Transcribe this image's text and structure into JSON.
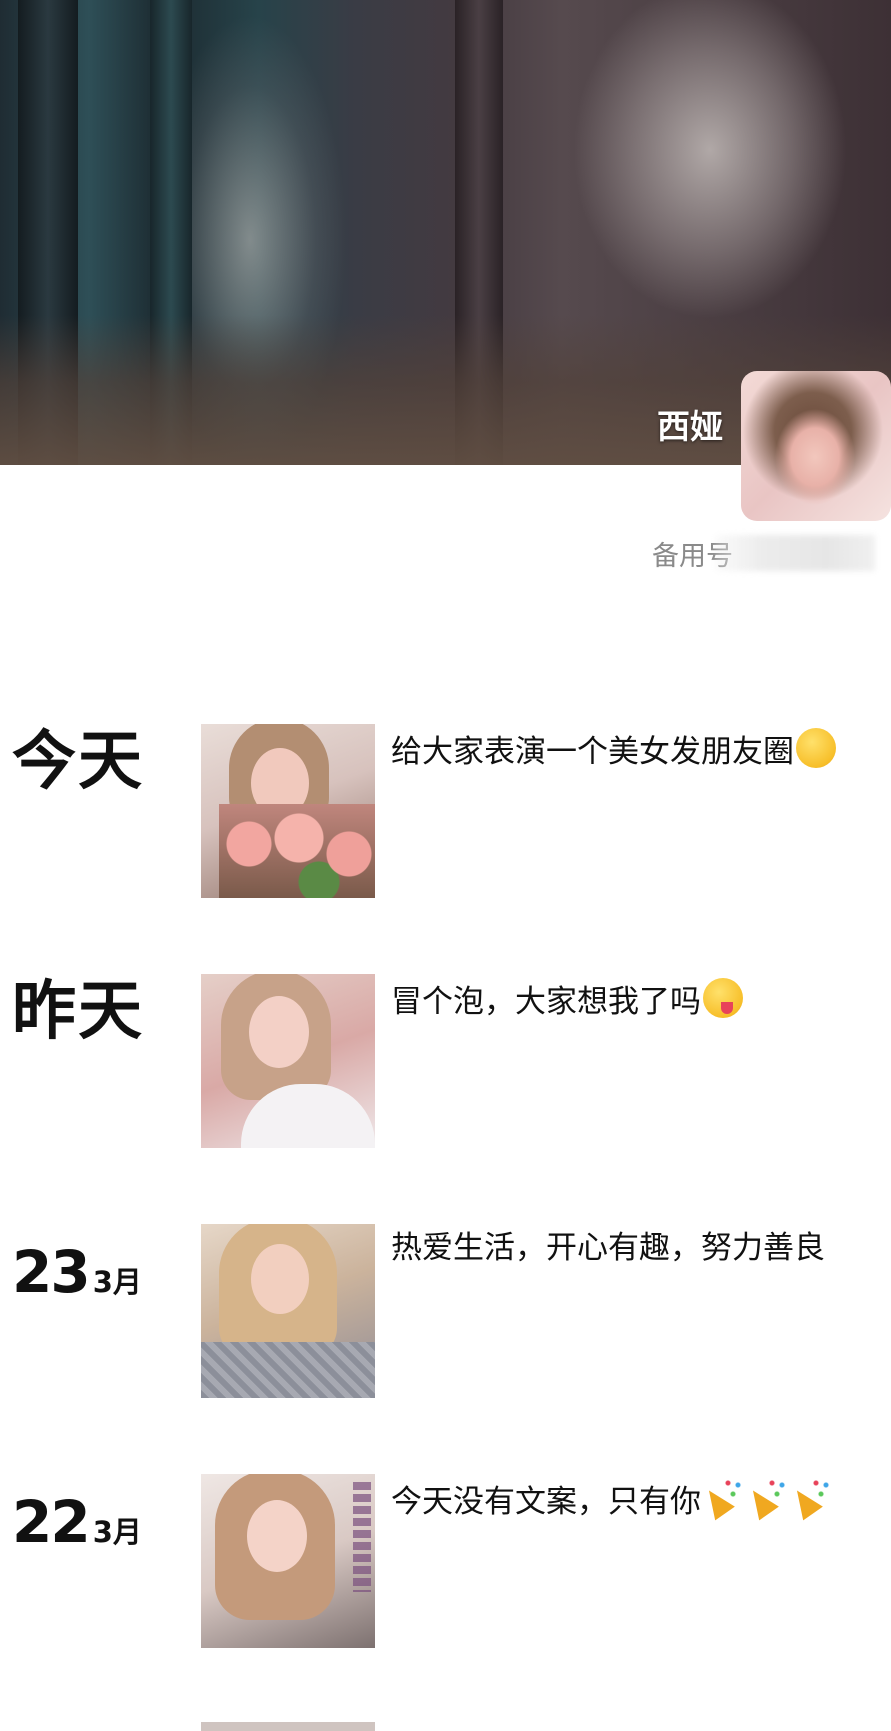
{
  "profile": {
    "name": "西娅",
    "account_label": "备用号"
  },
  "moments": [
    {
      "date_label": "今天",
      "text": "给大家表演一个美女发朋友圈",
      "emoji": "thinking-face-icon"
    },
    {
      "date_label": "昨天",
      "text": "冒个泡，大家想我了吗",
      "emoji": "winking-tongue-face-icon"
    },
    {
      "day": "23",
      "month": "3月",
      "text": "热爱生活，开心有趣，努力善良"
    },
    {
      "day": "22",
      "month": "3月",
      "text": "今天没有文案，只有你",
      "emoji": "party-popper-icon"
    }
  ]
}
